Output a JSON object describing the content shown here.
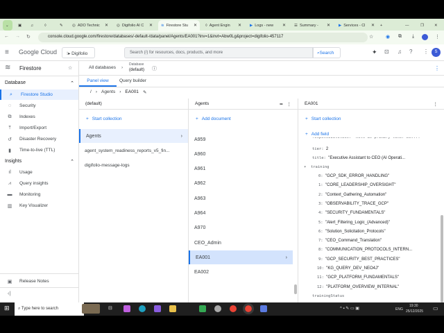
{
  "browser": {
    "tabs": [
      {
        "label": "ADO Technic"
      },
      {
        "label": "Digifolio AI C"
      },
      {
        "label": "Firestore Stu"
      },
      {
        "label": "Agent Engin"
      },
      {
        "label": "Logs - new"
      },
      {
        "label": "Summary -"
      },
      {
        "label": "Services - Cl"
      }
    ],
    "url": "console.cloud.google.com/firestore/databases/-default-/data/panel/Agents/EA001?inv=1&invt=Abw0Lg&project=digifolio-457117"
  },
  "header": {
    "logo": "Google Cloud",
    "project": "Digifolio",
    "search_placeholder": "Search (/) for resources, docs, products, and more",
    "search_button": "Search",
    "avatar": "S"
  },
  "sidebar": {
    "product": "Firestore",
    "section_database": "Database",
    "section_insights": "Insights",
    "database_items": [
      {
        "label": "Firestore Studio",
        "icon": "search-icon"
      },
      {
        "label": "Security",
        "icon": "shield-icon"
      },
      {
        "label": "Indexes",
        "icon": "indexes-icon"
      },
      {
        "label": "Import/Export",
        "icon": "upload-icon"
      },
      {
        "label": "Disaster Recovery",
        "icon": "history-icon"
      },
      {
        "label": "Time-to-live (TTL)",
        "icon": "trash-icon"
      }
    ],
    "insights_items": [
      {
        "label": "Usage"
      },
      {
        "label": "Query insights"
      },
      {
        "label": "Monitoring"
      },
      {
        "label": "Key Visualizer"
      }
    ],
    "release_notes": "Release Notes"
  },
  "top": {
    "all_databases": "All databases",
    "database_label": "Database",
    "database_value": "(default)"
  },
  "view_tabs": {
    "panel": "Panel view",
    "query": "Query builder"
  },
  "breadcrumb": {
    "root": "/",
    "collection": "Agents",
    "document": "EA001"
  },
  "col1": {
    "header": "(default)",
    "start_collection": "Start collection",
    "items": [
      "Agents",
      "agent_system_readiness_reports_v5_fin...",
      "digifolio-message-logs"
    ]
  },
  "col2": {
    "header": "Agents",
    "add_document": "Add document",
    "items": [
      "A959",
      "A960",
      "A961",
      "A962",
      "A963",
      "A964",
      "A970",
      "CEO_Admin",
      "EA001",
      "EA002"
    ]
  },
  "col3": {
    "header": "EA001",
    "start_collection": "Start collection",
    "add_field": "Add field",
    "partial": "responsibilities: \"Acts as primary liner bet...\"",
    "tier_key": "tier:",
    "tier_val": "2",
    "title_key": "title:",
    "title_val": "\"Executive Assistant to CEO (AI Operati...",
    "training_key": "training",
    "training": [
      "\"GCP_SDK_ERROR_HANDLING\"",
      "\"CORE_LEADERSHIP_OVERSIGHT\"",
      "\"Context_Gathering_Automation\"",
      "\"OBSERVABILITY_TRACE_GCP\"",
      "\"SECURITY_FUNDAMENTALS\"",
      "\"Alert_Filtering_Logic_(Advanced)\"",
      "\"Solution_Solicitation_Protocols\"",
      "\"CEO_Command_Translation\"",
      "\"COMMUNICATION_PROTOCOLS_INTERN...",
      "\"GCP_SECURITY_BEST_PRACTICES\"",
      "\"KG_QUERY_DEV_NEO4J\"",
      "\"GCP_PLATFORM_FUNDAMENTALS\"",
      "\"PLATFORM_OVERVIEW_INTERNAL\""
    ],
    "training_status": "trainingStatus"
  },
  "taskbar": {
    "search": "Type here to search",
    "lang": "ENG",
    "time": "19:30",
    "date": "25/12/2025"
  }
}
